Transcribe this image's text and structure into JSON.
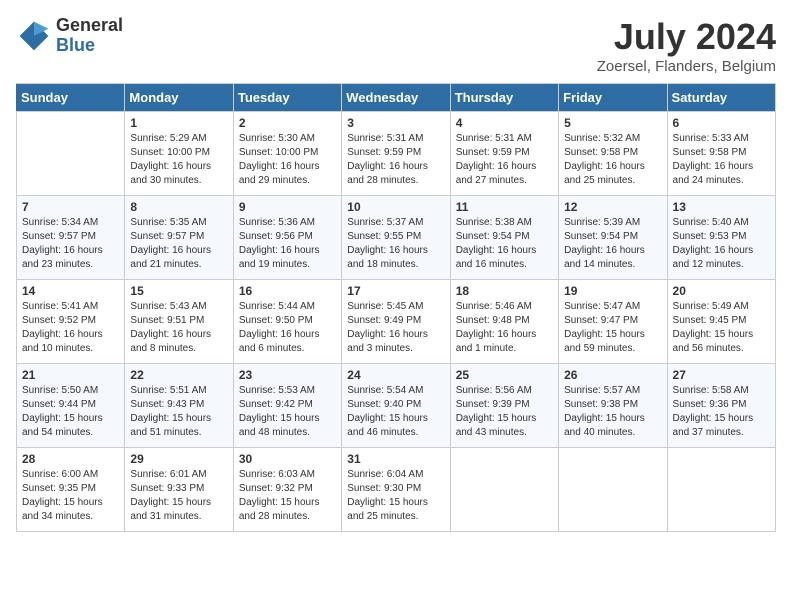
{
  "header": {
    "logo_general": "General",
    "logo_blue": "Blue",
    "title": "July 2024",
    "location": "Zoersel, Flanders, Belgium"
  },
  "columns": [
    "Sunday",
    "Monday",
    "Tuesday",
    "Wednesday",
    "Thursday",
    "Friday",
    "Saturday"
  ],
  "weeks": [
    [
      {
        "num": "",
        "info": ""
      },
      {
        "num": "1",
        "info": "Sunrise: 5:29 AM\nSunset: 10:00 PM\nDaylight: 16 hours\nand 30 minutes."
      },
      {
        "num": "2",
        "info": "Sunrise: 5:30 AM\nSunset: 10:00 PM\nDaylight: 16 hours\nand 29 minutes."
      },
      {
        "num": "3",
        "info": "Sunrise: 5:31 AM\nSunset: 9:59 PM\nDaylight: 16 hours\nand 28 minutes."
      },
      {
        "num": "4",
        "info": "Sunrise: 5:31 AM\nSunset: 9:59 PM\nDaylight: 16 hours\nand 27 minutes."
      },
      {
        "num": "5",
        "info": "Sunrise: 5:32 AM\nSunset: 9:58 PM\nDaylight: 16 hours\nand 25 minutes."
      },
      {
        "num": "6",
        "info": "Sunrise: 5:33 AM\nSunset: 9:58 PM\nDaylight: 16 hours\nand 24 minutes."
      }
    ],
    [
      {
        "num": "7",
        "info": "Sunrise: 5:34 AM\nSunset: 9:57 PM\nDaylight: 16 hours\nand 23 minutes."
      },
      {
        "num": "8",
        "info": "Sunrise: 5:35 AM\nSunset: 9:57 PM\nDaylight: 16 hours\nand 21 minutes."
      },
      {
        "num": "9",
        "info": "Sunrise: 5:36 AM\nSunset: 9:56 PM\nDaylight: 16 hours\nand 19 minutes."
      },
      {
        "num": "10",
        "info": "Sunrise: 5:37 AM\nSunset: 9:55 PM\nDaylight: 16 hours\nand 18 minutes."
      },
      {
        "num": "11",
        "info": "Sunrise: 5:38 AM\nSunset: 9:54 PM\nDaylight: 16 hours\nand 16 minutes."
      },
      {
        "num": "12",
        "info": "Sunrise: 5:39 AM\nSunset: 9:54 PM\nDaylight: 16 hours\nand 14 minutes."
      },
      {
        "num": "13",
        "info": "Sunrise: 5:40 AM\nSunset: 9:53 PM\nDaylight: 16 hours\nand 12 minutes."
      }
    ],
    [
      {
        "num": "14",
        "info": "Sunrise: 5:41 AM\nSunset: 9:52 PM\nDaylight: 16 hours\nand 10 minutes."
      },
      {
        "num": "15",
        "info": "Sunrise: 5:43 AM\nSunset: 9:51 PM\nDaylight: 16 hours\nand 8 minutes."
      },
      {
        "num": "16",
        "info": "Sunrise: 5:44 AM\nSunset: 9:50 PM\nDaylight: 16 hours\nand 6 minutes."
      },
      {
        "num": "17",
        "info": "Sunrise: 5:45 AM\nSunset: 9:49 PM\nDaylight: 16 hours\nand 3 minutes."
      },
      {
        "num": "18",
        "info": "Sunrise: 5:46 AM\nSunset: 9:48 PM\nDaylight: 16 hours\nand 1 minute."
      },
      {
        "num": "19",
        "info": "Sunrise: 5:47 AM\nSunset: 9:47 PM\nDaylight: 15 hours\nand 59 minutes."
      },
      {
        "num": "20",
        "info": "Sunrise: 5:49 AM\nSunset: 9:45 PM\nDaylight: 15 hours\nand 56 minutes."
      }
    ],
    [
      {
        "num": "21",
        "info": "Sunrise: 5:50 AM\nSunset: 9:44 PM\nDaylight: 15 hours\nand 54 minutes."
      },
      {
        "num": "22",
        "info": "Sunrise: 5:51 AM\nSunset: 9:43 PM\nDaylight: 15 hours\nand 51 minutes."
      },
      {
        "num": "23",
        "info": "Sunrise: 5:53 AM\nSunset: 9:42 PM\nDaylight: 15 hours\nand 48 minutes."
      },
      {
        "num": "24",
        "info": "Sunrise: 5:54 AM\nSunset: 9:40 PM\nDaylight: 15 hours\nand 46 minutes."
      },
      {
        "num": "25",
        "info": "Sunrise: 5:56 AM\nSunset: 9:39 PM\nDaylight: 15 hours\nand 43 minutes."
      },
      {
        "num": "26",
        "info": "Sunrise: 5:57 AM\nSunset: 9:38 PM\nDaylight: 15 hours\nand 40 minutes."
      },
      {
        "num": "27",
        "info": "Sunrise: 5:58 AM\nSunset: 9:36 PM\nDaylight: 15 hours\nand 37 minutes."
      }
    ],
    [
      {
        "num": "28",
        "info": "Sunrise: 6:00 AM\nSunset: 9:35 PM\nDaylight: 15 hours\nand 34 minutes."
      },
      {
        "num": "29",
        "info": "Sunrise: 6:01 AM\nSunset: 9:33 PM\nDaylight: 15 hours\nand 31 minutes."
      },
      {
        "num": "30",
        "info": "Sunrise: 6:03 AM\nSunset: 9:32 PM\nDaylight: 15 hours\nand 28 minutes."
      },
      {
        "num": "31",
        "info": "Sunrise: 6:04 AM\nSunset: 9:30 PM\nDaylight: 15 hours\nand 25 minutes."
      },
      {
        "num": "",
        "info": ""
      },
      {
        "num": "",
        "info": ""
      },
      {
        "num": "",
        "info": ""
      }
    ]
  ]
}
